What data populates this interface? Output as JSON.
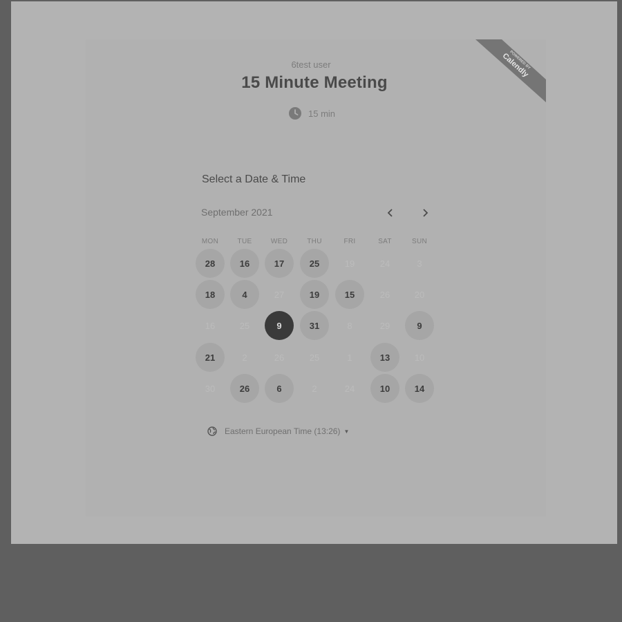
{
  "event": {
    "host": "6test user",
    "title": "15 Minute Meeting",
    "duration": "15 min"
  },
  "badge": {
    "line1": "POWERED BY",
    "line2": "Calendly"
  },
  "scheduler": {
    "heading": "Select a Date & Time",
    "month": "September 2021",
    "weekdays": [
      "MON",
      "TUE",
      "WED",
      "THU",
      "FRI",
      "SAT",
      "SUN"
    ],
    "weeks": [
      [
        {
          "label": "28",
          "state": "available"
        },
        {
          "label": "16",
          "state": "available"
        },
        {
          "label": "17",
          "state": "available"
        },
        {
          "label": "25",
          "state": "available"
        },
        {
          "label": "19",
          "state": "disabled"
        },
        {
          "label": "24",
          "state": "disabled"
        },
        {
          "label": "3",
          "state": "disabled"
        }
      ],
      [
        {
          "label": "18",
          "state": "available"
        },
        {
          "label": "4",
          "state": "available"
        },
        {
          "label": "27",
          "state": "disabled"
        },
        {
          "label": "19",
          "state": "available"
        },
        {
          "label": "15",
          "state": "available"
        },
        {
          "label": "26",
          "state": "disabled"
        },
        {
          "label": "20",
          "state": "disabled"
        }
      ],
      [
        {
          "label": "16",
          "state": "disabled"
        },
        {
          "label": "25",
          "state": "disabled"
        },
        {
          "label": "9",
          "state": "selected"
        },
        {
          "label": "31",
          "state": "available"
        },
        {
          "label": "8",
          "state": "disabled"
        },
        {
          "label": "29",
          "state": "disabled"
        },
        {
          "label": "9",
          "state": "available"
        }
      ],
      [
        {
          "label": "21",
          "state": "available"
        },
        {
          "label": "2",
          "state": "disabled"
        },
        {
          "label": "26",
          "state": "disabled"
        },
        {
          "label": "25",
          "state": "disabled"
        },
        {
          "label": "1",
          "state": "disabled"
        },
        {
          "label": "13",
          "state": "available"
        },
        {
          "label": "10",
          "state": "disabled"
        }
      ],
      [
        {
          "label": "30",
          "state": "disabled"
        },
        {
          "label": "26",
          "state": "available"
        },
        {
          "label": "6",
          "state": "available"
        },
        {
          "label": "2",
          "state": "disabled"
        },
        {
          "label": "24",
          "state": "disabled"
        },
        {
          "label": "10",
          "state": "available"
        },
        {
          "label": "14",
          "state": "available"
        }
      ]
    ],
    "timezone": "Eastern European Time (13:26)"
  },
  "icons": {
    "duration": "clock-icon",
    "timezone": "globe-icon",
    "prev": "chevron-left-icon",
    "next": "chevron-right-icon",
    "timezone_toggle": "caret-down-icon"
  }
}
